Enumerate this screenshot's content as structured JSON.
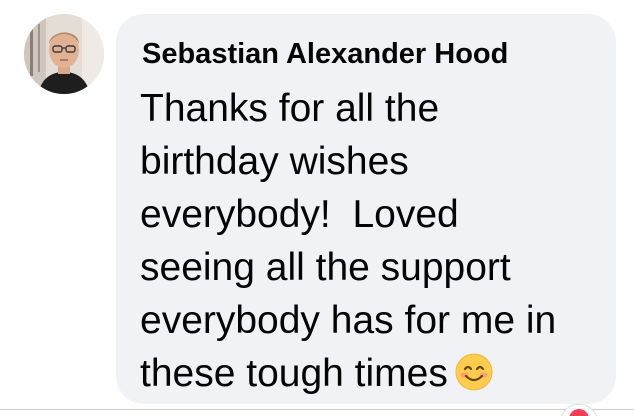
{
  "comment": {
    "author": "Sebastian Alexander Hood",
    "lines": [
      "Thanks for all the",
      "birthday wishes",
      "everybody!  Loved",
      "seeing all the support",
      "everybody has for me in",
      "these tough times"
    ],
    "emoji": "smiling-face-with-smiling-eyes"
  },
  "colors": {
    "bubble_bg": "#f0f2f5",
    "text": "#050505",
    "emoji_face": "#ffcc4d",
    "reaction": "#f33e58"
  }
}
